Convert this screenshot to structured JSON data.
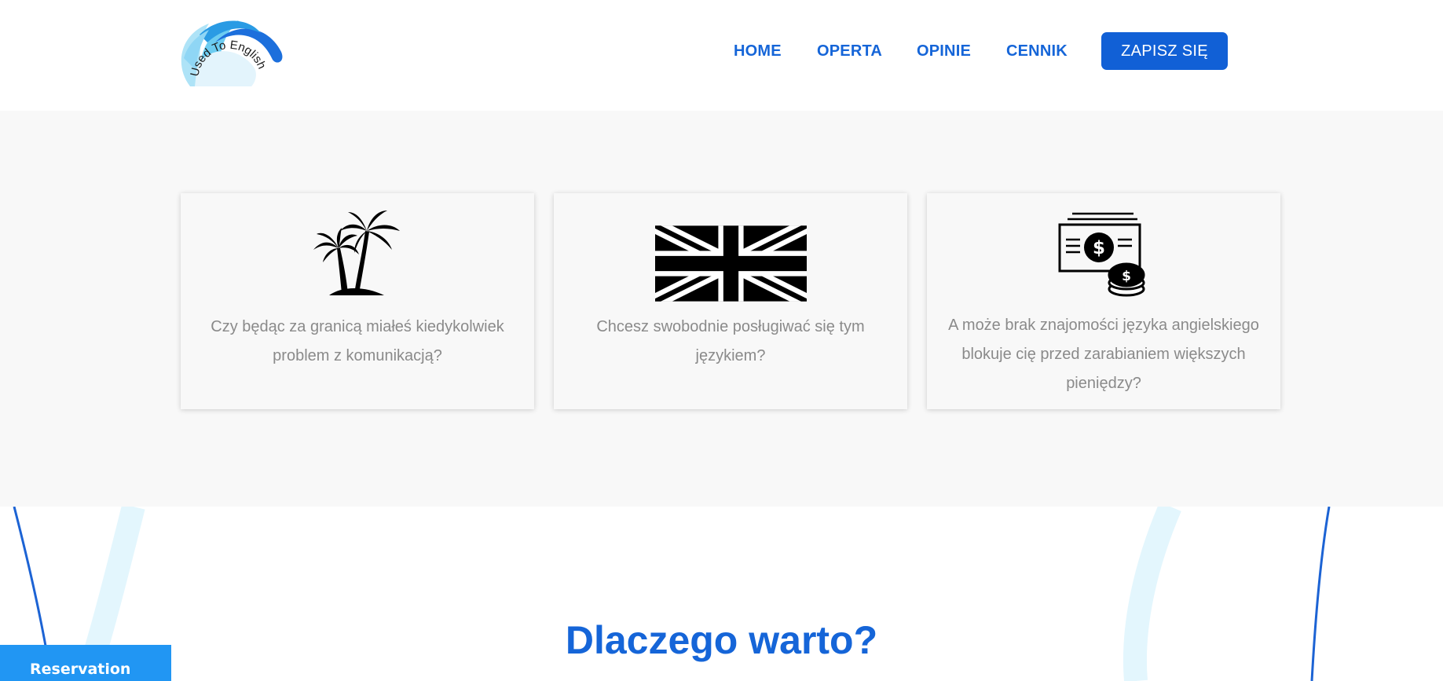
{
  "header": {
    "logo_text": "Used To English",
    "nav": {
      "home": "HOME",
      "oferta": "OPERTA",
      "opinie": "OPINIE",
      "cennik": "CENNIK"
    },
    "cta_label": "ZAPISZ SIĘ"
  },
  "features": {
    "cards": [
      {
        "icon": "palm-trees-icon",
        "text": "Czy będąc za granicą miałeś kiedykolwiek problem z komunikacją?"
      },
      {
        "icon": "uk-flag-icon",
        "text": "Chcesz swobodnie posługiwać się tym językiem?"
      },
      {
        "icon": "money-icon",
        "text": "A może brak znajomości języka angielskiego blokuje cię przed zarabianiem większych pieniędzy?"
      }
    ]
  },
  "why": {
    "title": "Dlaczego warto?"
  },
  "reservation": {
    "label": "Reservation"
  },
  "colors": {
    "accent": "#1565d8",
    "button": "#1160d6",
    "reservation": "#2196f3",
    "section_bg": "#f8f8f8",
    "text_muted": "#8a8a8a"
  }
}
